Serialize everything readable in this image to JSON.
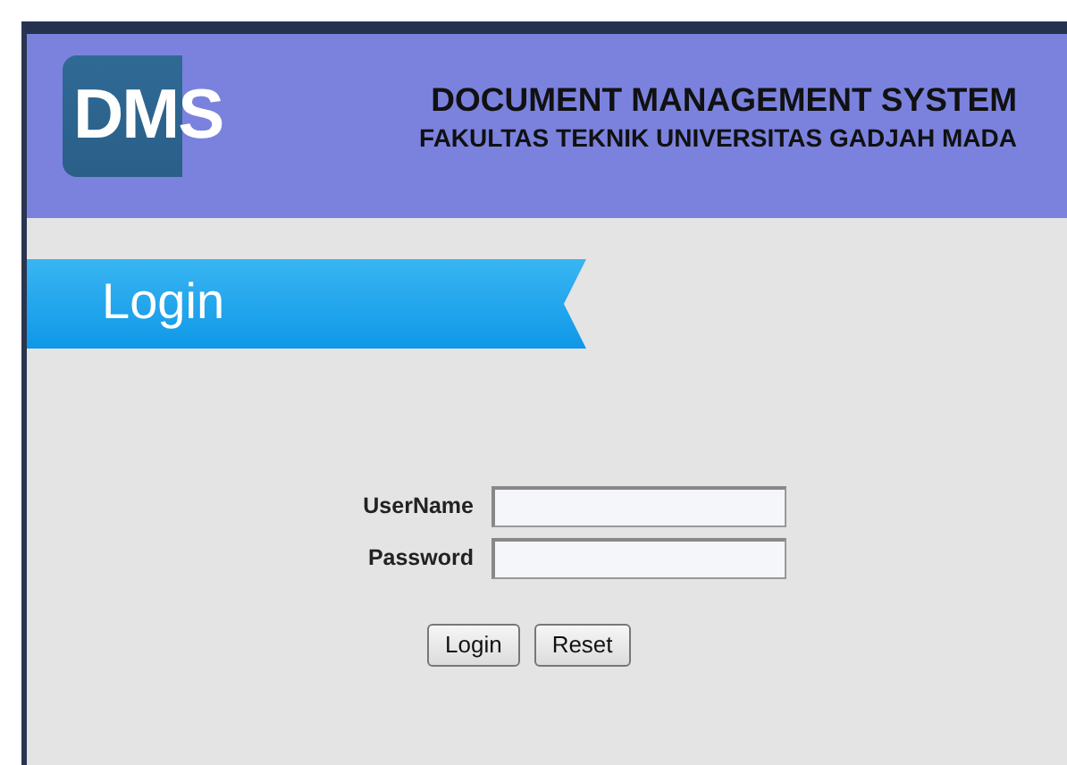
{
  "header": {
    "logo": "DMS",
    "title": "DOCUMENT MANAGEMENT SYSTEM",
    "subtitle": "FAKULTAS TEKNIK UNIVERSITAS GADJAH MADA"
  },
  "section_title": "Login",
  "form": {
    "fields": [
      {
        "label": "UserName"
      },
      {
        "label": "Password"
      }
    ],
    "buttons": [
      "Login",
      "Reset"
    ]
  }
}
